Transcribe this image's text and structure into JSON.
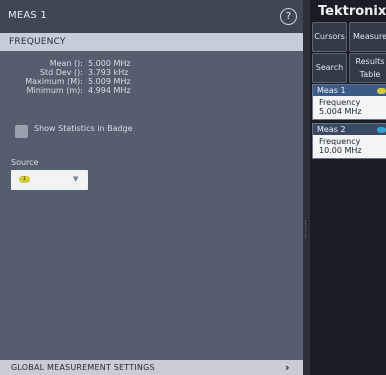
{
  "panel": {
    "title": "MEAS 1",
    "help_icon": "?",
    "section": "FREQUENCY",
    "stats": [
      {
        "label": "Mean ():",
        "value": "5.000 MHz"
      },
      {
        "label": "Std Dev ():",
        "value": "3.793 kHz"
      },
      {
        "label": "Maximum (M):",
        "value": "5.009 MHz"
      },
      {
        "label": "Minimum (m):",
        "value": "4.994 MHz"
      }
    ],
    "show_stats_label": "Show Statistics in Badge",
    "show_stats_checked": false,
    "source_label": "Source",
    "source_value": "1",
    "source_color": "#d6cc2e",
    "dropdown_icon": "chevron-down-icon",
    "global_settings": "GLOBAL MEASUREMENT SETTINGS",
    "global_chevron": "›"
  },
  "sidebar": {
    "brand": "Tektronix",
    "buttons": {
      "cursors": "Cursors",
      "measure": "Measure",
      "search": "Search",
      "results_line1": "Results",
      "results_line2": "Table"
    },
    "badges": [
      {
        "title": "Meas 1",
        "measurement": "Frequency",
        "value": "5.004 MHz",
        "source_color": "#d6cc2e"
      },
      {
        "title": "Meas 2",
        "measurement": "Frequency",
        "value": "10.00 MHz",
        "source_color": "#2ea7d6"
      }
    ]
  },
  "colors": {
    "panel_bg": "#565d6c",
    "section_header": "#c7cdd8",
    "sidebar_bg": "#1a1d23",
    "badge_header": "#3d5a86"
  }
}
